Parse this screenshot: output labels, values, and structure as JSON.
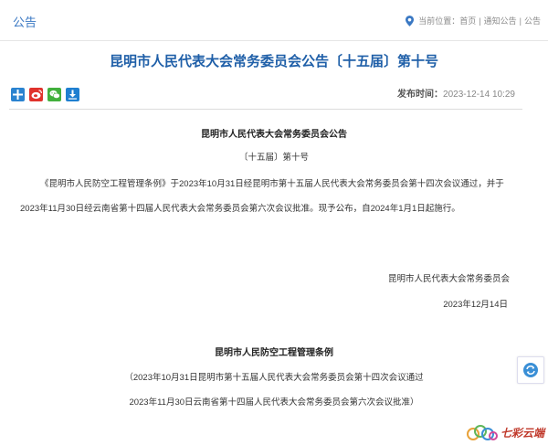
{
  "header": {
    "section": "公告",
    "breadcrumb": {
      "prefix": "当前位置：",
      "items": [
        "首页",
        "通知公告",
        "公告"
      ],
      "separator": "|"
    }
  },
  "article": {
    "title": "昆明市人民代表大会常务委员会公告〔十五届〕第十号",
    "publish_label": "发布时间：",
    "publish_time": "2023-12-14 10:29",
    "doc_heading": "昆明市人民代表大会常务委员会公告",
    "doc_number": "〔十五届〕第十号",
    "paragraph": "《昆明市人民防空工程管理条例》于2023年10月31日经昆明市第十五届人民代表大会常务委员会第十四次会议通过，并于2023年11月30日经云南省第十四届人民代表大会常务委员会第六次会议批准。现予公布，自2024年1月1日起施行。",
    "signature_org": "昆明市人民代表大会常务委员会",
    "signature_date": "2023年12月14日",
    "regulation_title": "昆明市人民防空工程管理条例",
    "regulation_note_1": "（2023年10月31日昆明市第十五届人民代表大会常务委员会第十四次会议通过",
    "regulation_note_2": "2023年11月30日云南省第十四届人民代表大会常务委员会第六次会议批准）"
  },
  "share": {
    "icons": [
      "add-icon",
      "weibo-icon",
      "wechat-icon",
      "download-icon"
    ]
  },
  "logo": {
    "text": "七彩云端"
  },
  "colors": {
    "accent": "#3a78c3",
    "title": "#1f5fa8",
    "weibo": "#e0322c",
    "wechat": "#42b03d"
  }
}
